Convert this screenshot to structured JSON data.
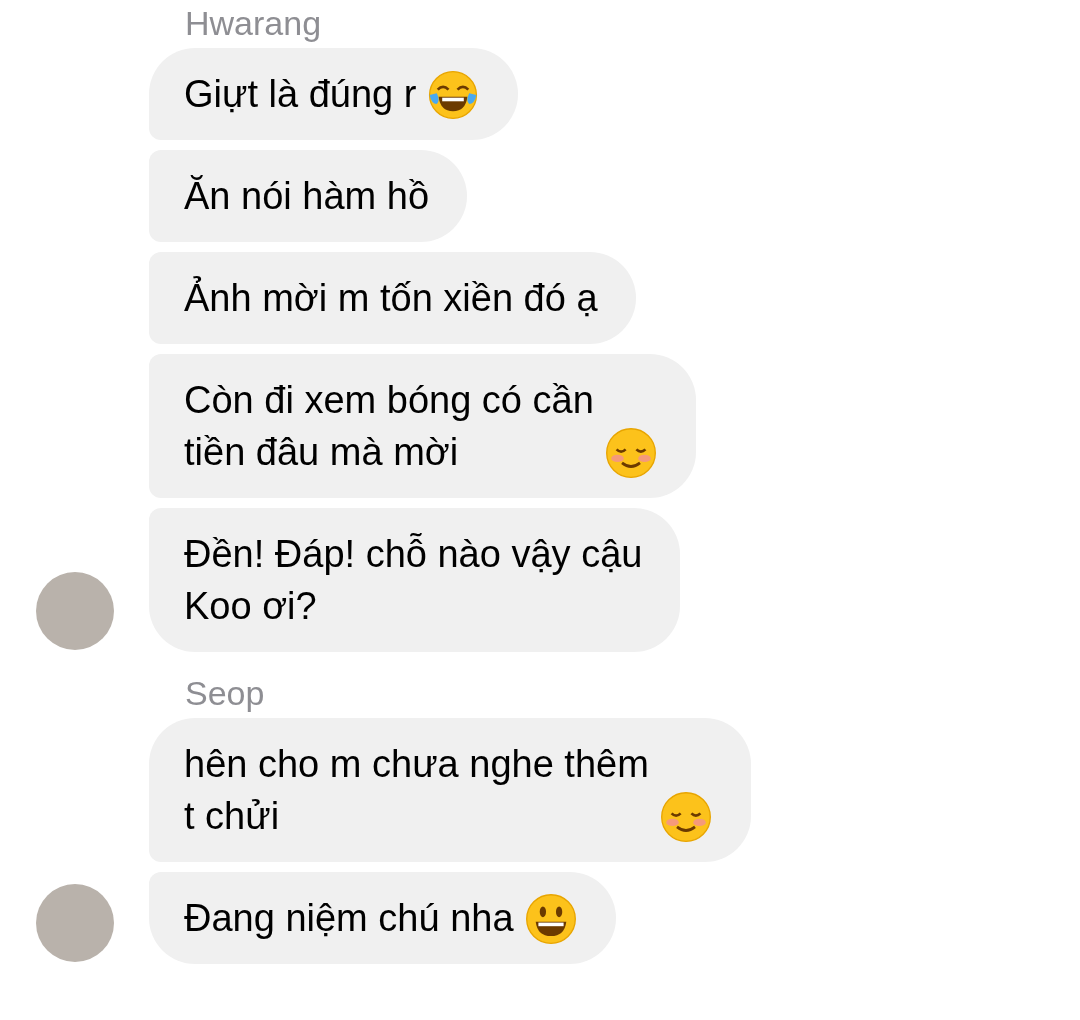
{
  "groups": [
    {
      "sender": "Hwarang",
      "messages": [
        {
          "text": "Giựt là đúng r",
          "kind": "tears-of-joy"
        },
        {
          "text": "Ăn nói hàm hồ"
        },
        {
          "text": "Ảnh mời m tốn xiền đó ạ"
        },
        {
          "text": "Còn đi xem bóng có cần\ntiền đâu mà mời",
          "kind": "smiling"
        },
        {
          "text": "Đền! Đáp! chỗ nào vậy cậu\nKoo ơi?"
        }
      ]
    },
    {
      "sender": "Seop",
      "messages": [
        {
          "text": "hên cho m chưa nghe thêm\nt chửi",
          "kind": "smiling"
        },
        {
          "text": "Đang niệm chú nha",
          "kind": "grinning"
        }
      ]
    }
  ]
}
